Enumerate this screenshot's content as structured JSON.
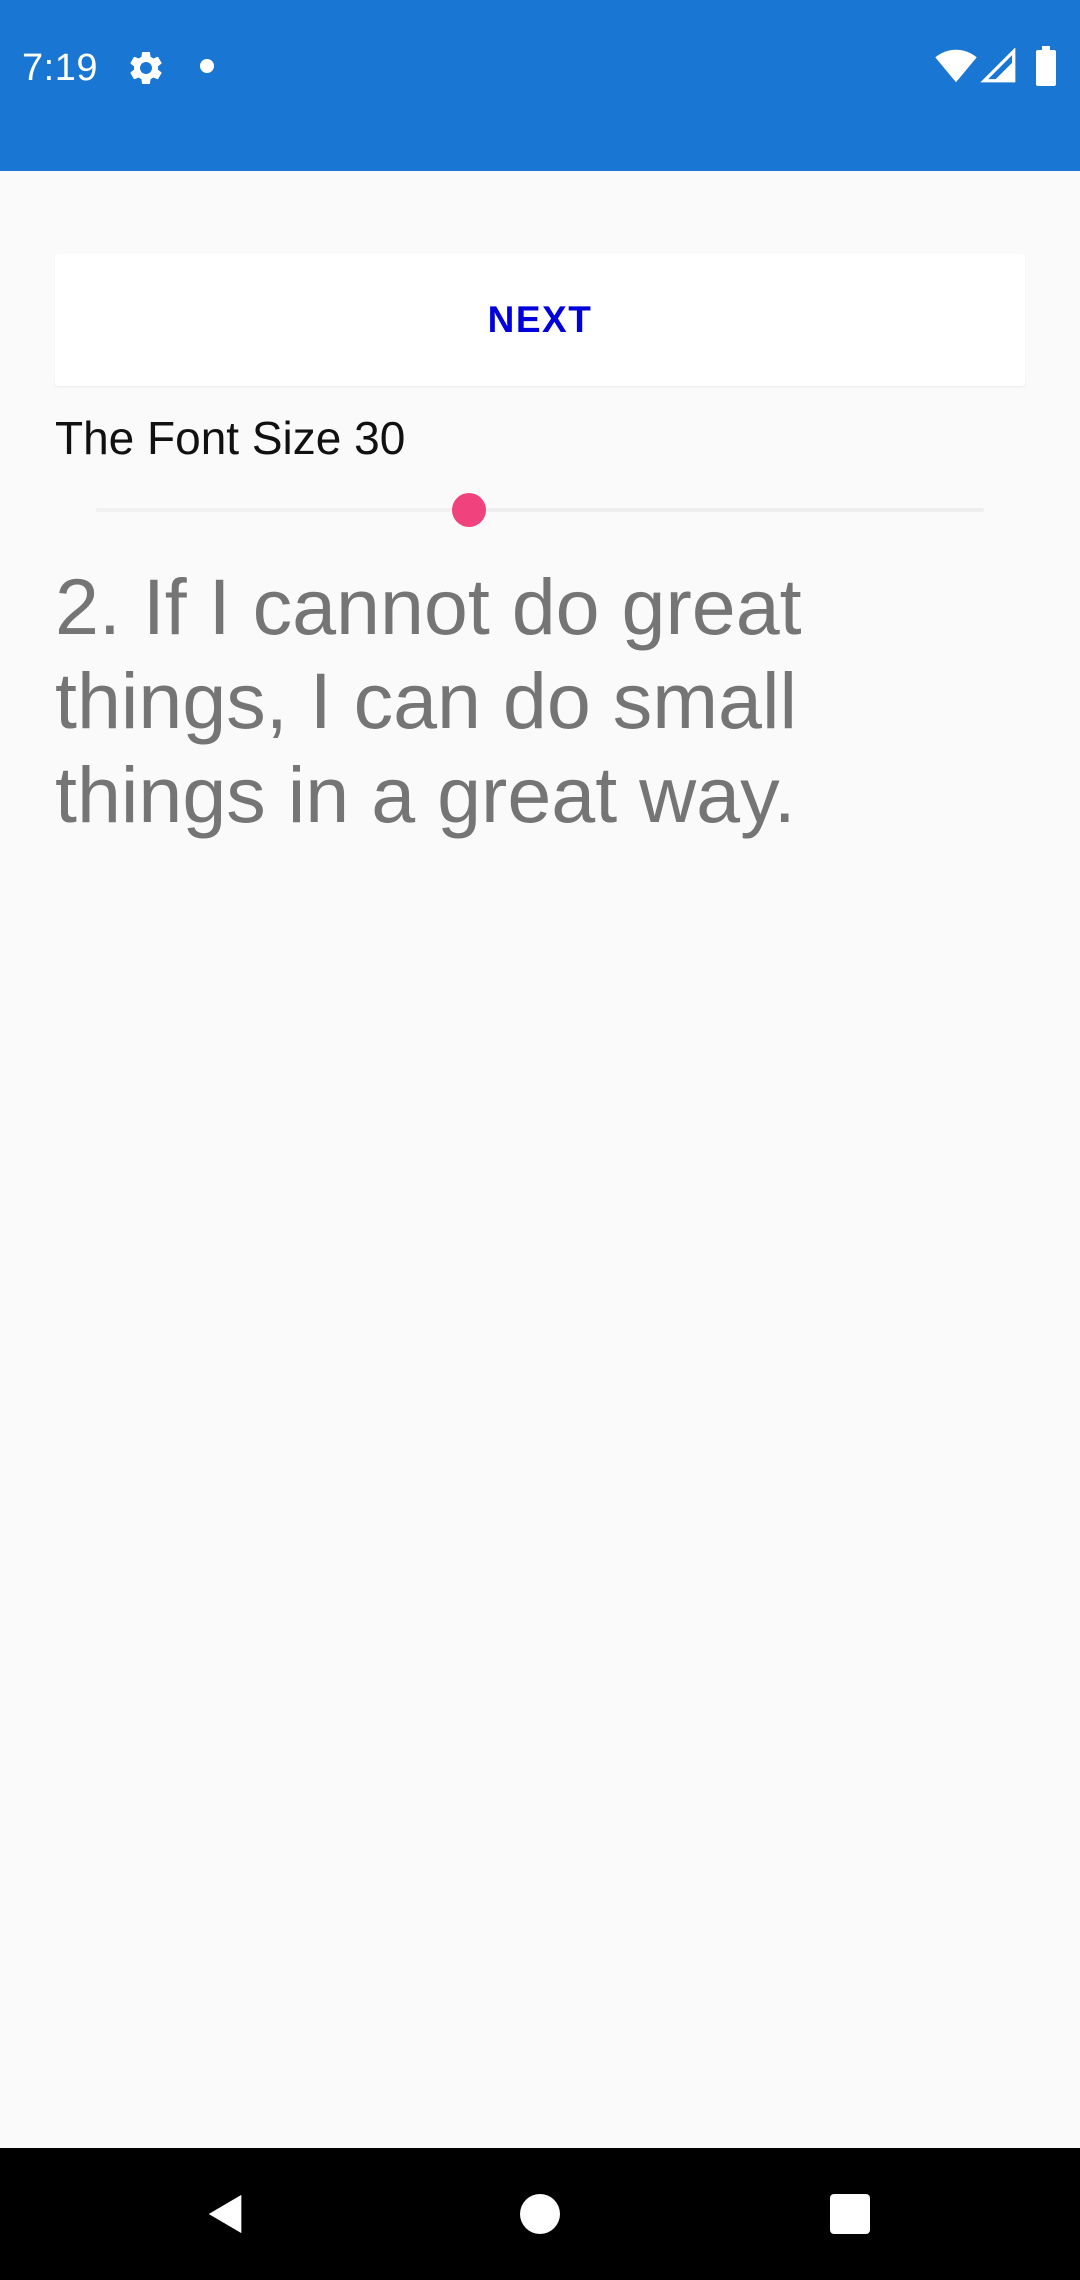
{
  "status_bar": {
    "time": "7:19",
    "background_color": "#1976d2",
    "icons": [
      "gear-icon",
      "notification-dot-icon",
      "wifi-icon",
      "signal-icon",
      "battery-icon"
    ]
  },
  "next_button": {
    "label": "NEXT",
    "label_color": "#0000dd"
  },
  "font_size": {
    "label": "The Font Size 30",
    "slider_fraction": 0.42,
    "thumb_color": "#f0437d"
  },
  "quote": {
    "text": "2. If I cannot do great things, I can do small things in a great way."
  },
  "nav_bar": {
    "icons": [
      "back-icon",
      "home-icon",
      "recents-icon"
    ]
  }
}
